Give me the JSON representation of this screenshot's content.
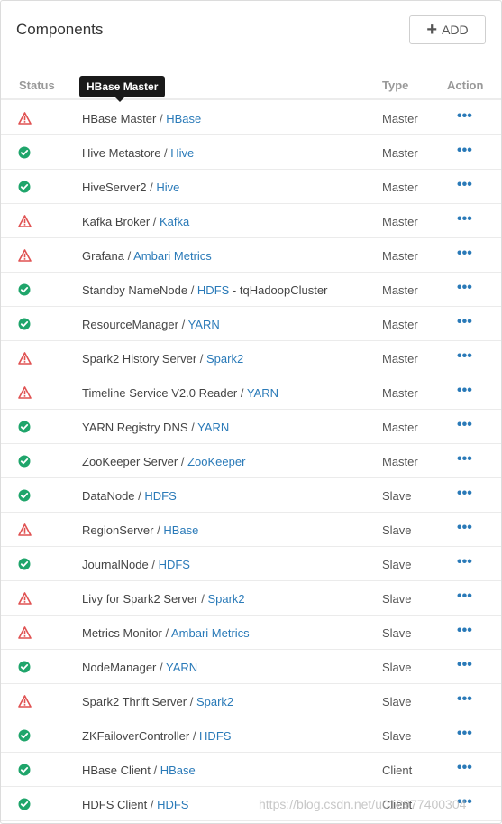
{
  "header": {
    "title": "Components",
    "add_label": "ADD"
  },
  "columns": {
    "status": "Status",
    "type": "Type",
    "action": "Action"
  },
  "tooltip": "HBase Master",
  "status_colors": {
    "ok": "#1fa56b",
    "warn": "#e05252"
  },
  "rows": [
    {
      "name": "HBase Master",
      "service": "HBase",
      "type": "Master",
      "status": "warn"
    },
    {
      "name": "Hive Metastore",
      "service": "Hive",
      "type": "Master",
      "status": "ok"
    },
    {
      "name": "HiveServer2",
      "service": "Hive",
      "type": "Master",
      "status": "ok"
    },
    {
      "name": "Kafka Broker",
      "service": "Kafka",
      "type": "Master",
      "status": "warn"
    },
    {
      "name": "Grafana",
      "service": "Ambari Metrics",
      "type": "Master",
      "status": "warn"
    },
    {
      "name": "Standby NameNode",
      "service": "HDFS",
      "suffix": " - tqHadoopCluster",
      "type": "Master",
      "status": "ok"
    },
    {
      "name": "ResourceManager",
      "service": "YARN",
      "type": "Master",
      "status": "ok"
    },
    {
      "name": "Spark2 History Server",
      "service": "Spark2",
      "type": "Master",
      "status": "warn"
    },
    {
      "name": "Timeline Service V2.0 Reader",
      "service": "YARN",
      "type": "Master",
      "status": "warn"
    },
    {
      "name": "YARN Registry DNS",
      "service": "YARN",
      "type": "Master",
      "status": "ok"
    },
    {
      "name": "ZooKeeper Server",
      "service": "ZooKeeper",
      "type": "Master",
      "status": "ok"
    },
    {
      "name": "DataNode",
      "service": "HDFS",
      "type": "Slave",
      "status": "ok"
    },
    {
      "name": "RegionServer",
      "service": "HBase",
      "type": "Slave",
      "status": "warn"
    },
    {
      "name": "JournalNode",
      "service": "HDFS",
      "type": "Slave",
      "status": "ok"
    },
    {
      "name": "Livy for Spark2 Server",
      "service": "Spark2",
      "type": "Slave",
      "status": "warn"
    },
    {
      "name": "Metrics Monitor",
      "service": "Ambari Metrics",
      "type": "Slave",
      "status": "warn"
    },
    {
      "name": "NodeManager",
      "service": "YARN",
      "type": "Slave",
      "status": "ok"
    },
    {
      "name": "Spark2 Thrift Server",
      "service": "Spark2",
      "type": "Slave",
      "status": "warn"
    },
    {
      "name": "ZKFailoverController",
      "service": "HDFS",
      "type": "Slave",
      "status": "ok"
    },
    {
      "name": "HBase Client",
      "service": "HBase",
      "type": "Client",
      "status": "ok"
    },
    {
      "name": "HDFS Client",
      "service": "HDFS",
      "type": "Client",
      "status": "ok"
    }
  ],
  "action_glyph": "•••",
  "watermark": "https://blog.csdn.net/u012977400304"
}
